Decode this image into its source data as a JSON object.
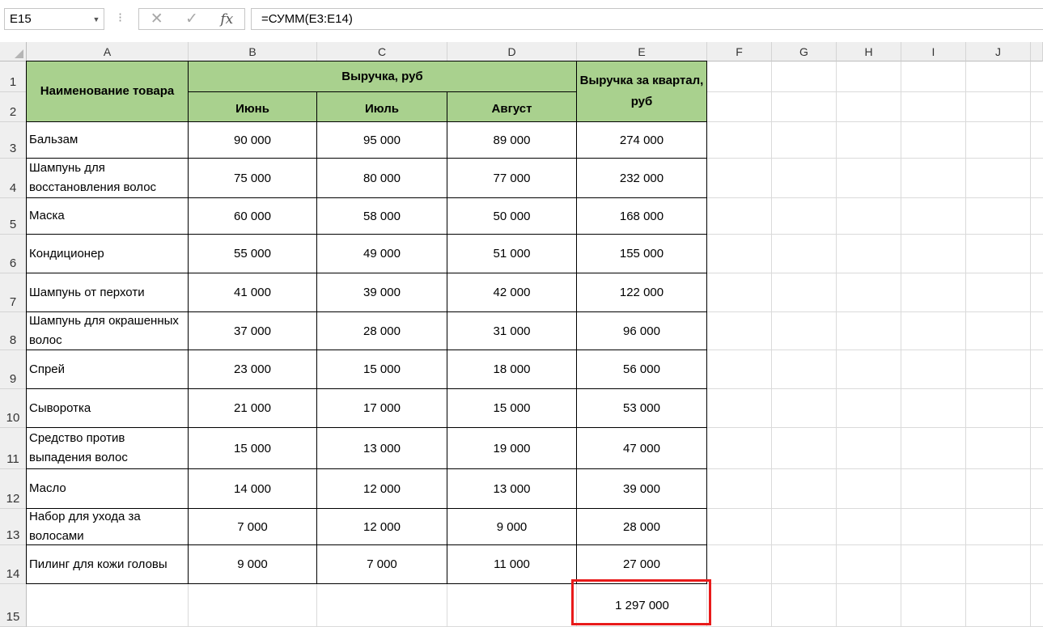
{
  "formula_bar": {
    "name_box": "E15",
    "formula": "=СУММ(E3:E14)",
    "cancel_icon": "✕",
    "enter_icon": "✓",
    "fx_label": "fx"
  },
  "columns": [
    "A",
    "B",
    "C",
    "D",
    "E",
    "F",
    "G",
    "H",
    "I",
    "J"
  ],
  "rows": [
    "1",
    "2",
    "3",
    "4",
    "5",
    "6",
    "7",
    "8",
    "9",
    "10",
    "11",
    "12",
    "13",
    "14",
    "15"
  ],
  "table": {
    "header_name": "Наименование товара",
    "header_revenue": "Выручка, руб",
    "header_quarter": "Выручка за квартал, руб",
    "months": [
      "Июнь",
      "Июль",
      "Август"
    ],
    "items": [
      {
        "name": "Бальзам",
        "june": "90 000",
        "july": "95 000",
        "august": "89 000",
        "total": "274 000"
      },
      {
        "name": "Шампунь для восстановления волос",
        "june": "75 000",
        "july": "80 000",
        "august": "77 000",
        "total": "232 000"
      },
      {
        "name": "Маска",
        "june": "60 000",
        "july": "58 000",
        "august": "50 000",
        "total": "168 000"
      },
      {
        "name": "Кондиционер",
        "june": "55 000",
        "july": "49 000",
        "august": "51 000",
        "total": "155 000"
      },
      {
        "name": "Шампунь от перхоти",
        "june": "41 000",
        "july": "39 000",
        "august": "42 000",
        "total": "122 000"
      },
      {
        "name": "Шампунь для окрашенных волос",
        "june": "37 000",
        "july": "28 000",
        "august": "31 000",
        "total": "96 000"
      },
      {
        "name": "Спрей",
        "june": "23 000",
        "july": "15 000",
        "august": "18 000",
        "total": "56 000"
      },
      {
        "name": "Сыворотка",
        "june": "21 000",
        "july": "17 000",
        "august": "15 000",
        "total": "53 000"
      },
      {
        "name": "Средство против выпадения волос",
        "june": "15 000",
        "july": "13 000",
        "august": "19 000",
        "total": "47 000"
      },
      {
        "name": "Масло",
        "june": "14 000",
        "july": "12 000",
        "august": "13 000",
        "total": "39 000"
      },
      {
        "name": "Набор для ухода за волосами",
        "june": "7 000",
        "july": "12 000",
        "august": "9 000",
        "total": "28 000"
      },
      {
        "name": "Пилинг для кожи головы",
        "june": "9 000",
        "july": "7 000",
        "august": "11 000",
        "total": "27 000"
      }
    ],
    "grand_total": "1 297 000"
  },
  "colors": {
    "header_fill": "#a9d18e",
    "selection_border": "#e81b1b"
  }
}
